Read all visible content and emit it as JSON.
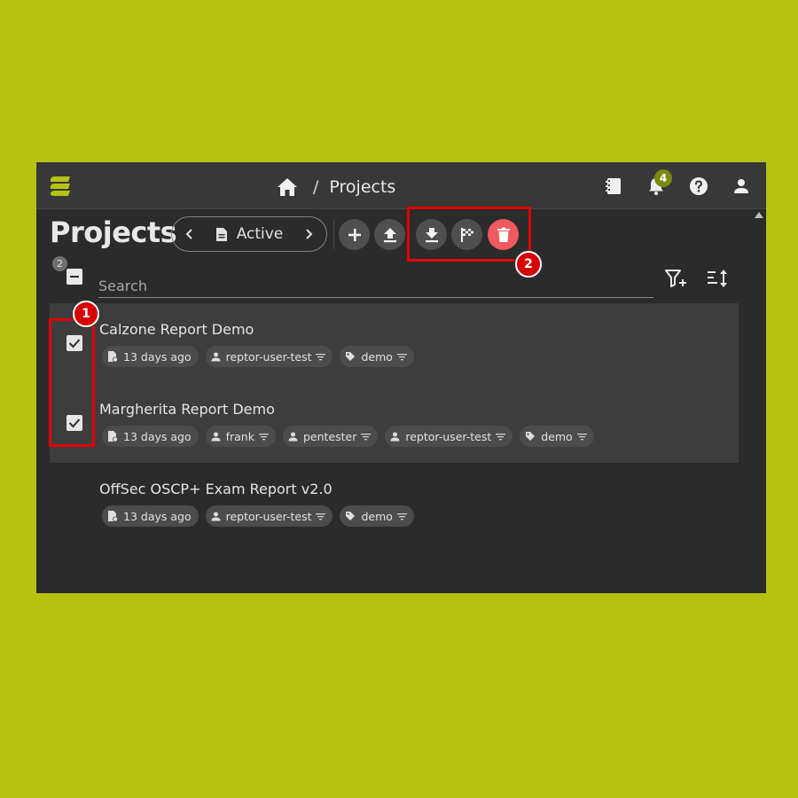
{
  "header": {
    "logo_icon": "reportcreator-logo-icon",
    "breadcrumb_home_icon": "home-icon",
    "breadcrumb_separator": "/",
    "breadcrumb_current": "Projects",
    "notification_count": "4"
  },
  "toolbar": {
    "title": "Projects",
    "filter_status": "Active",
    "selected_count": "2"
  },
  "search": {
    "placeholder": "Search"
  },
  "annotations": {
    "one": "1",
    "two": "2"
  },
  "projects": [
    {
      "name": "Calzone Report Demo",
      "selected": true,
      "chips": [
        {
          "type": "date",
          "label": "13 days ago"
        },
        {
          "type": "user",
          "label": "reptor-user-test"
        },
        {
          "type": "tag",
          "label": "demo"
        }
      ]
    },
    {
      "name": "Margherita Report Demo",
      "selected": true,
      "chips": [
        {
          "type": "date",
          "label": "13 days ago"
        },
        {
          "type": "user",
          "label": "frank"
        },
        {
          "type": "user",
          "label": "pentester"
        },
        {
          "type": "user",
          "label": "reptor-user-test"
        },
        {
          "type": "tag",
          "label": "demo"
        }
      ]
    },
    {
      "name": "OffSec OSCP+ Exam Report v2.0",
      "selected": false,
      "chips": [
        {
          "type": "date",
          "label": "13 days ago"
        },
        {
          "type": "user",
          "label": "reptor-user-test"
        },
        {
          "type": "tag",
          "label": "demo"
        }
      ]
    }
  ],
  "colors": {
    "accent": "#b5c30f",
    "danger": "#ef5a5f",
    "highlight": "#e30000"
  }
}
